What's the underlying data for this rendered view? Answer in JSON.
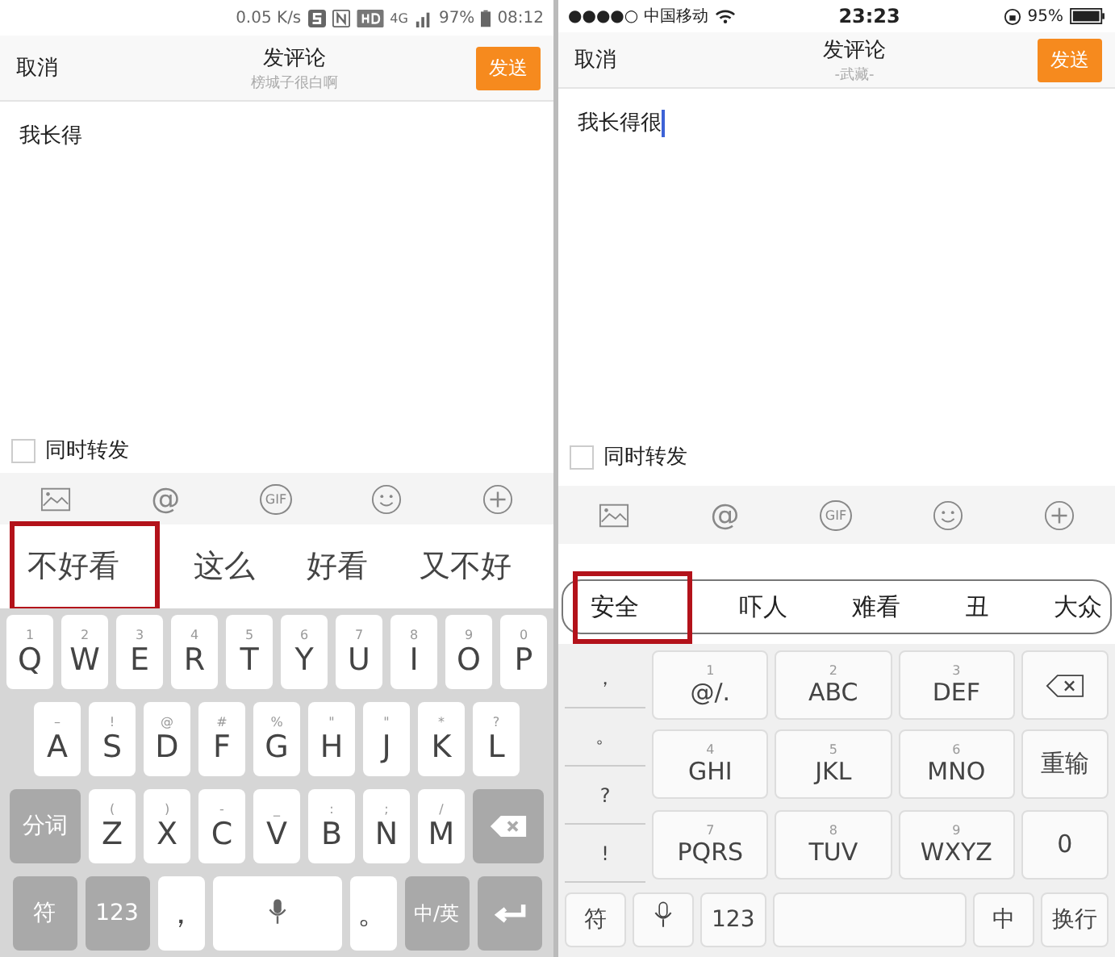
{
  "phones": [
    {
      "kind": "android",
      "status": {
        "speed": "0.05 K/s",
        "network": "4G",
        "battery": "97%",
        "time": "08:12"
      },
      "header": {
        "cancel": "取消",
        "title": "发评论",
        "subtitle": "榜城子很白啊",
        "send": "发送"
      },
      "text": "我长得",
      "cursor": false,
      "forward": {
        "label": "同时转发",
        "checked": false
      },
      "toolbar": [
        {
          "kind": "image"
        },
        {
          "kind": "at",
          "text": "@"
        },
        {
          "kind": "gif",
          "text": "GIF"
        },
        {
          "kind": "emoji"
        },
        {
          "kind": "plus"
        }
      ],
      "candidates": [
        {
          "text": "不好看",
          "highlighted": true
        },
        {
          "text": "这么",
          "highlighted": false
        },
        {
          "text": "好看",
          "highlighted": false
        },
        {
          "text": "又不好",
          "highlighted": false
        }
      ],
      "keyboard": {
        "kind": "qwerty",
        "rows": [
          [
            {
              "kind": "char",
              "main": "Q",
              "sub": "1"
            },
            {
              "kind": "char",
              "main": "W",
              "sub": "2"
            },
            {
              "kind": "char",
              "main": "E",
              "sub": "3"
            },
            {
              "kind": "char",
              "main": "R",
              "sub": "4"
            },
            {
              "kind": "char",
              "main": "T",
              "sub": "5"
            },
            {
              "kind": "char",
              "main": "Y",
              "sub": "6"
            },
            {
              "kind": "char",
              "main": "U",
              "sub": "7"
            },
            {
              "kind": "char",
              "main": "I",
              "sub": "8"
            },
            {
              "kind": "char",
              "main": "O",
              "sub": "9"
            },
            {
              "kind": "char",
              "main": "P",
              "sub": "0"
            }
          ],
          [
            {
              "kind": "char",
              "main": "A",
              "sub": "–"
            },
            {
              "kind": "char",
              "main": "S",
              "sub": "!"
            },
            {
              "kind": "char",
              "main": "D",
              "sub": "@"
            },
            {
              "kind": "char",
              "main": "F",
              "sub": "#"
            },
            {
              "kind": "char",
              "main": "G",
              "sub": "%"
            },
            {
              "kind": "char",
              "main": "H",
              "sub": "\""
            },
            {
              "kind": "char",
              "main": "J",
              "sub": "\""
            },
            {
              "kind": "char",
              "main": "K",
              "sub": "*"
            },
            {
              "kind": "char",
              "main": "L",
              "sub": "?"
            }
          ],
          [
            {
              "kind": "func",
              "main": "分词"
            },
            {
              "kind": "char",
              "main": "Z",
              "sub": "("
            },
            {
              "kind": "char",
              "main": "X",
              "sub": ")"
            },
            {
              "kind": "char",
              "main": "C",
              "sub": "-"
            },
            {
              "kind": "char",
              "main": "V",
              "sub": "_"
            },
            {
              "kind": "char",
              "main": "B",
              "sub": ":"
            },
            {
              "kind": "char",
              "main": "N",
              "sub": ";"
            },
            {
              "kind": "char",
              "main": "M",
              "sub": "/"
            },
            {
              "kind": "backspace"
            }
          ]
        ],
        "bottom": [
          {
            "kind": "func",
            "main": "符"
          },
          {
            "kind": "func",
            "main": "123"
          },
          {
            "kind": "char",
            "main": "，"
          },
          {
            "kind": "space"
          },
          {
            "kind": "char",
            "main": "。"
          },
          {
            "kind": "func",
            "main": "中/英"
          },
          {
            "kind": "enter"
          }
        ]
      }
    },
    {
      "kind": "ios",
      "status": {
        "left": "●●●●○ 中国移动",
        "battery": "95%",
        "time": "23:23"
      },
      "header": {
        "cancel": "取消",
        "title": "发评论",
        "subtitle": "-武藏-",
        "send": "发送"
      },
      "text": "我长得很",
      "cursor": true,
      "forward": {
        "label": "同时转发",
        "checked": false
      },
      "toolbar": [
        {
          "kind": "image"
        },
        {
          "kind": "at",
          "text": "@"
        },
        {
          "kind": "gif",
          "text": "GIF"
        },
        {
          "kind": "emoji"
        },
        {
          "kind": "plus"
        }
      ],
      "candidates": [
        {
          "text": "安全",
          "highlighted": true
        },
        {
          "text": "吓人",
          "highlighted": false
        },
        {
          "text": "难看",
          "highlighted": false
        },
        {
          "text": "丑",
          "highlighted": false
        },
        {
          "text": "大众",
          "highlighted": false
        }
      ],
      "keyboard": {
        "kind": "ninekey",
        "side": [
          "，",
          "。",
          "?",
          "!"
        ],
        "rows": [
          [
            {
              "kind": "char",
              "main": "@/.",
              "sub": "1"
            },
            {
              "kind": "char",
              "main": "ABC",
              "sub": "2"
            },
            {
              "kind": "char",
              "main": "DEF",
              "sub": "3"
            },
            {
              "kind": "backspace"
            }
          ],
          [
            {
              "kind": "char",
              "main": "GHI",
              "sub": "4"
            },
            {
              "kind": "char",
              "main": "JKL",
              "sub": "5"
            },
            {
              "kind": "char",
              "main": "MNO",
              "sub": "6"
            },
            {
              "kind": "char",
              "main": "重输"
            }
          ],
          [
            {
              "kind": "char",
              "main": "PQRS",
              "sub": "7"
            },
            {
              "kind": "char",
              "main": "TUV",
              "sub": "8"
            },
            {
              "kind": "char",
              "main": "WXYZ",
              "sub": "9"
            },
            {
              "kind": "char",
              "main": "0"
            }
          ]
        ],
        "bottom": [
          {
            "kind": "char",
            "main": "符"
          },
          {
            "kind": "mic"
          },
          {
            "kind": "char",
            "main": "123"
          },
          {
            "kind": "space"
          },
          {
            "kind": "globe",
            "main": "中"
          },
          {
            "kind": "char",
            "main": "换行"
          }
        ]
      }
    }
  ]
}
